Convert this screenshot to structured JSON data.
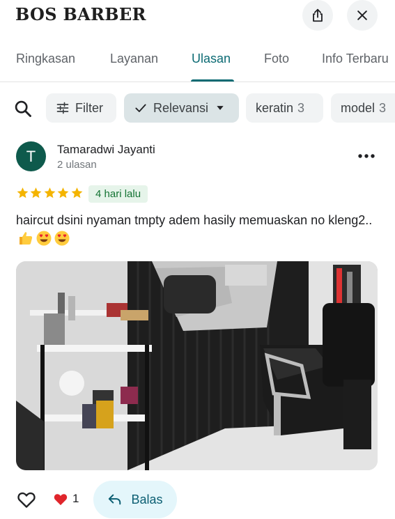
{
  "header": {
    "title": "BOS BARBER",
    "share_icon": "share-icon",
    "close_icon": "close-icon"
  },
  "tabs": [
    {
      "label": "Ringkasan",
      "active": false
    },
    {
      "label": "Layanan",
      "active": false
    },
    {
      "label": "Ulasan",
      "active": true
    },
    {
      "label": "Foto",
      "active": false
    },
    {
      "label": "Info Terbaru",
      "active": false
    }
  ],
  "filters": {
    "search_icon": "search-icon",
    "chips": [
      {
        "label": "Filter",
        "icon": "sliders-icon"
      },
      {
        "label": "Relevansi",
        "icon": "check-icon",
        "selected": true
      },
      {
        "label": "keratin",
        "count": "3"
      },
      {
        "label": "model",
        "count": "3"
      }
    ]
  },
  "review": {
    "avatar_letter": "T",
    "name": "Tamaradwi Jayanti",
    "meta": "2 ulasan",
    "rating": 5,
    "date": "4 hari lalu",
    "text": "haircut dsini nyaman tmpty adem hasily memuaskan no kleng2..",
    "emojis": [
      "thumbs-up",
      "heart-eyes",
      "heart-eyes"
    ],
    "photo_alt": "barbershop interior"
  },
  "actions": {
    "reaction_count": "1",
    "reply_label": "Balas"
  },
  "colors": {
    "accent": "#0b6a73",
    "avatar": "#0e5a4c",
    "star": "#f4b400",
    "badge_bg": "#e6f4ea",
    "badge_text": "#137333",
    "reply_bg": "#e4f6fb"
  }
}
